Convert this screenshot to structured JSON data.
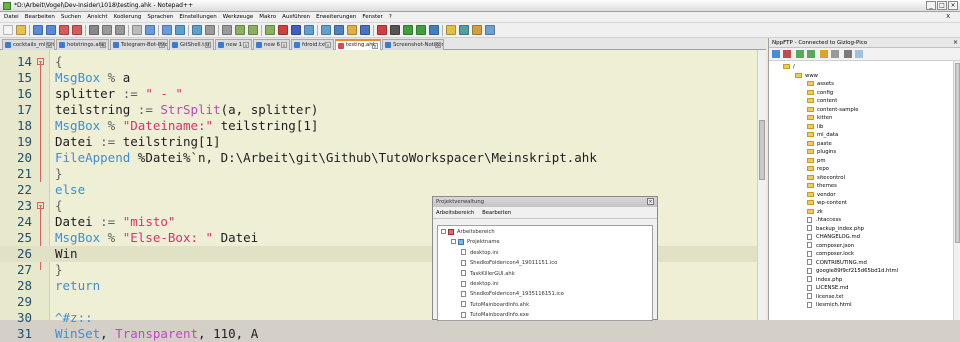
{
  "window": {
    "title": "*D:\\Arbeit\\Vogel\\Dev-Insider\\1018\\testing.ahk - Notepad++",
    "controls": [
      "_",
      "□",
      "×"
    ]
  },
  "menubar": {
    "items": [
      "Datei",
      "Bearbeiten",
      "Suchen",
      "Ansicht",
      "Kodierung",
      "Sprachen",
      "Einstellungen",
      "Werkzeuge",
      "Makro",
      "Ausführen",
      "Erweiterungen",
      "Fenster",
      "?"
    ],
    "right": "X"
  },
  "tabs": [
    {
      "label": "cocktails_ml.txt",
      "active": false
    },
    {
      "label": "hotstrings.ahk",
      "active": false
    },
    {
      "label": "Telegram-Bot-Infos.txt",
      "active": false
    },
    {
      "label": "GitShell.txt",
      "active": false
    },
    {
      "label": "new 1",
      "active": false
    },
    {
      "label": "new 6",
      "active": false
    },
    {
      "label": "fdroid.txt",
      "active": false
    },
    {
      "label": "testing.ahk",
      "active": true
    },
    {
      "label": "Screenshot-Notizen.txt",
      "active": false
    }
  ],
  "editor": {
    "current_line": 26,
    "lines": [
      {
        "n": "14",
        "fold": "minus",
        "tokens": [
          {
            "t": "{",
            "c": "op"
          }
        ]
      },
      {
        "n": "15",
        "tokens": [
          {
            "t": "MsgBox",
            "c": "kw"
          },
          {
            "t": " % ",
            "c": "op"
          },
          {
            "t": "a",
            "c": ""
          }
        ]
      },
      {
        "n": "16",
        "tokens": [
          {
            "t": "splitter ",
            "c": ""
          },
          {
            "t": ":=",
            "c": "op"
          },
          {
            "t": " ",
            "c": ""
          },
          {
            "t": "\" - \"",
            "c": "str"
          }
        ]
      },
      {
        "n": "17",
        "tokens": [
          {
            "t": "teilstring ",
            "c": ""
          },
          {
            "t": ":=",
            "c": "op"
          },
          {
            "t": " ",
            "c": ""
          },
          {
            "t": "StrSplit",
            "c": "fn"
          },
          {
            "t": "(a, splitter)",
            "c": ""
          }
        ]
      },
      {
        "n": "18",
        "tokens": [
          {
            "t": "MsgBox",
            "c": "kw"
          },
          {
            "t": " % ",
            "c": "op"
          },
          {
            "t": "\"Dateiname:\"",
            "c": "str"
          },
          {
            "t": " teilstring[1]",
            "c": ""
          }
        ]
      },
      {
        "n": "19",
        "tokens": [
          {
            "t": "Datei ",
            "c": ""
          },
          {
            "t": ":=",
            "c": "op"
          },
          {
            "t": " teilstring[1]",
            "c": ""
          }
        ]
      },
      {
        "n": "20",
        "tokens": [
          {
            "t": "FileAppend",
            "c": "kw"
          },
          {
            "t": " %Datei%`n, D:\\Arbeit\\git\\Github\\TutoWorkspacer\\Meinskript.ahk",
            "c": ""
          }
        ]
      },
      {
        "n": "21",
        "tokens": [
          {
            "t": "}",
            "c": "op"
          }
        ]
      },
      {
        "n": "22",
        "tokens": [
          {
            "t": "else",
            "c": "kw"
          }
        ]
      },
      {
        "n": "23",
        "fold": "minus",
        "tokens": [
          {
            "t": "{",
            "c": "op"
          }
        ]
      },
      {
        "n": "24",
        "tokens": [
          {
            "t": "Datei ",
            "c": ""
          },
          {
            "t": ":=",
            "c": "op"
          },
          {
            "t": " ",
            "c": ""
          },
          {
            "t": "\"misto\"",
            "c": "str"
          }
        ]
      },
      {
        "n": "25",
        "tokens": [
          {
            "t": "MsgBox",
            "c": "kw"
          },
          {
            "t": " % ",
            "c": "op"
          },
          {
            "t": "\"Else-Box: \"",
            "c": "str"
          },
          {
            "t": " Datei",
            "c": ""
          }
        ]
      },
      {
        "n": "26",
        "tokens": [
          {
            "t": "Win",
            "c": ""
          }
        ]
      },
      {
        "n": "27",
        "tokens": [
          {
            "t": "}",
            "c": "op"
          }
        ]
      },
      {
        "n": "28",
        "tokens": [
          {
            "t": "return",
            "c": "kw"
          }
        ]
      },
      {
        "n": "29",
        "tokens": []
      },
      {
        "n": "30",
        "tokens": [
          {
            "t": "^#z::",
            "c": "kw"
          }
        ]
      },
      {
        "n": "31",
        "tokens": [
          {
            "t": "WinSet",
            "c": "kw"
          },
          {
            "t": ", ",
            "c": ""
          },
          {
            "t": "Transparent",
            "c": "fn"
          },
          {
            "t": ", 110, A",
            "c": ""
          }
        ]
      }
    ]
  },
  "ftp": {
    "title": "NppFTP - Connected to Gizlog-Pico",
    "close": "×",
    "tree": [
      {
        "label": "/",
        "type": "folder",
        "indent": 0
      },
      {
        "label": "www",
        "type": "folder",
        "indent": 1
      },
      {
        "label": "assets",
        "type": "folder",
        "indent": 2
      },
      {
        "label": "config",
        "type": "folder",
        "indent": 2
      },
      {
        "label": "content",
        "type": "folder",
        "indent": 2
      },
      {
        "label": "content-sample",
        "type": "folder",
        "indent": 2
      },
      {
        "label": "kitten",
        "type": "folder",
        "indent": 2
      },
      {
        "label": "lib",
        "type": "folder",
        "indent": 2
      },
      {
        "label": "ml_data",
        "type": "folder",
        "indent": 2
      },
      {
        "label": "paste",
        "type": "folder",
        "indent": 2
      },
      {
        "label": "plugins",
        "type": "folder",
        "indent": 2
      },
      {
        "label": "pm",
        "type": "folder",
        "indent": 2
      },
      {
        "label": "repo",
        "type": "folder",
        "indent": 2
      },
      {
        "label": "sitecontrol",
        "type": "folder",
        "indent": 2
      },
      {
        "label": "themes",
        "type": "folder",
        "indent": 2
      },
      {
        "label": "vendor",
        "type": "folder",
        "indent": 2
      },
      {
        "label": "wp-content",
        "type": "folder",
        "indent": 2
      },
      {
        "label": "zk",
        "type": "folder",
        "indent": 2
      },
      {
        "label": ".htaccess",
        "type": "file",
        "indent": 2
      },
      {
        "label": "backup_index.php",
        "type": "file",
        "indent": 2
      },
      {
        "label": "CHANGELOG.md",
        "type": "file",
        "indent": 2
      },
      {
        "label": "composer.json",
        "type": "file",
        "indent": 2
      },
      {
        "label": "composer.lock",
        "type": "file",
        "indent": 2
      },
      {
        "label": "CONTRIBUTING.md",
        "type": "file",
        "indent": 2
      },
      {
        "label": "google89f9cf215d65bd1d.html",
        "type": "file",
        "indent": 2
      },
      {
        "label": "index.php",
        "type": "file",
        "indent": 2
      },
      {
        "label": "LICENSE.md",
        "type": "file",
        "indent": 2
      },
      {
        "label": "license.txt",
        "type": "file",
        "indent": 2
      },
      {
        "label": "liesmich.html",
        "type": "file",
        "indent": 2
      }
    ]
  },
  "projekt": {
    "title": "Projektverwaltung",
    "close": "×",
    "menu": [
      "Arbeitsbereich",
      "Bearbeiten"
    ],
    "tree": [
      {
        "label": "Arbeitsbereich",
        "type": "ws",
        "indent": 0
      },
      {
        "label": "Projektname",
        "type": "proj",
        "indent": 1
      },
      {
        "label": "desktop.ini",
        "type": "file",
        "indent": 2
      },
      {
        "label": "ShedkoFoldericon4_19011151.ico",
        "type": "file",
        "indent": 2
      },
      {
        "label": "TaskKillerGUI.ahk",
        "type": "file",
        "indent": 2
      },
      {
        "label": "desktop.ini",
        "type": "file",
        "indent": 2
      },
      {
        "label": "ShedkoFoldericon4_1935116151.ico",
        "type": "file",
        "indent": 2
      },
      {
        "label": "TutoMainboardInfo.ahk",
        "type": "file",
        "indent": 2
      },
      {
        "label": "TutoMainboardInfo.exe",
        "type": "file",
        "indent": 2
      }
    ]
  }
}
